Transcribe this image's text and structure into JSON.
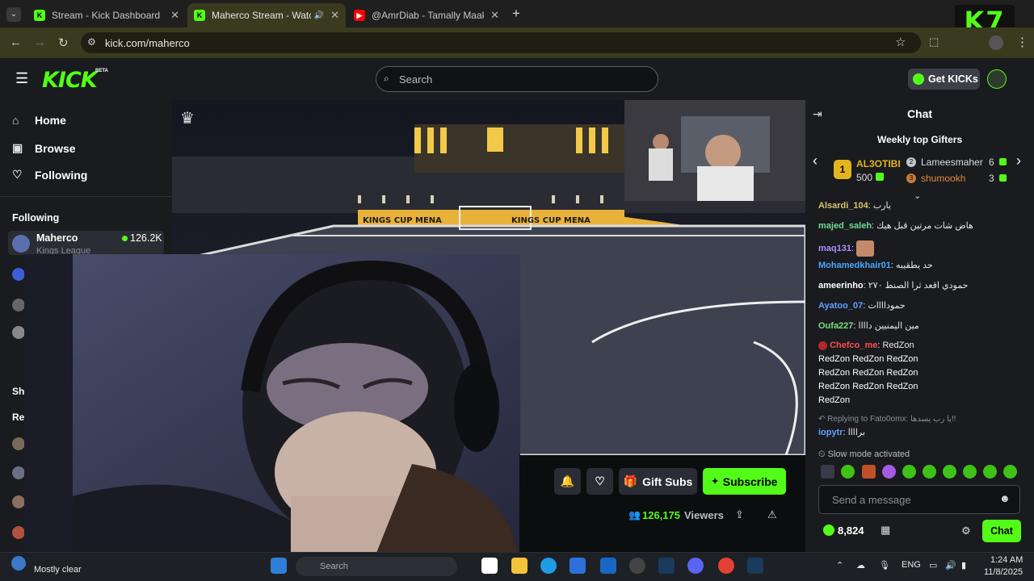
{
  "browser": {
    "tabs": [
      {
        "title": "Stream - Kick Dashboard",
        "favicon": "kick-icon"
      },
      {
        "title": "Maherco Stream - Watch Li",
        "favicon": "kick-icon"
      },
      {
        "title": "@AmrDiab - Tamally Maak | Off",
        "favicon": "youtube-icon"
      }
    ],
    "url": "kick.com/maherco",
    "overlay_badge": "K7"
  },
  "kick": {
    "logo": "KICK",
    "beta": "BETA",
    "search_placeholder": "Search",
    "get_kicks": "Get KICKs"
  },
  "sidebar": {
    "nav": [
      {
        "label": "Home",
        "icon": "home-icon"
      },
      {
        "label": "Browse",
        "icon": "browse-icon"
      },
      {
        "label": "Following",
        "icon": "heart-icon"
      }
    ],
    "following_heading": "Following",
    "channels": [
      {
        "name": "Maherco",
        "category": "Kings League",
        "viewers": "126.2K",
        "live": true
      }
    ],
    "partial_headings": [
      "She",
      "Re"
    ]
  },
  "stream": {
    "scoreboard_text": "KINGS CUP MENA",
    "actions": {
      "gift_subs": "Gift Subs",
      "subscribe": "Subscribe"
    },
    "viewers_count": "126,175",
    "viewers_label": "Viewers"
  },
  "chat": {
    "title": "Chat",
    "top_gifters_title": "Weekly top Gifters",
    "gifters": [
      {
        "rank": "1",
        "name": "AL3OTIBI",
        "count": "500"
      },
      {
        "rank": "2",
        "name": "Lameesmaher",
        "count": "6"
      },
      {
        "rank": "3",
        "name": "shumookh",
        "count": "3"
      }
    ],
    "messages": [
      {
        "user": "Alsardi_104",
        "text": "يارب",
        "color": "#d6c36a"
      },
      {
        "user": "majed_saleh",
        "text": "هاض شات مرتين قبل هيك",
        "color": "#6fdc91"
      },
      {
        "user": "maq131",
        "text": "",
        "color": "#b08cff"
      },
      {
        "user": "Mohamedkhair01",
        "text": "حد يطقيبه",
        "color": "#4aa8ff"
      },
      {
        "user": "ameerinho",
        "text": "حمودي اقعد ثرا الصنط ٢٧٠",
        "color": "#ffffff"
      },
      {
        "user": "Ayatoo_07",
        "text": "حموداااات",
        "color": "#62a3ff"
      },
      {
        "user": "Oufa227",
        "text": "مين اليمنيين داااا",
        "color": "#79e07b"
      },
      {
        "user": "Chefco_me",
        "text": "RedZon",
        "color": "#ff4f4f"
      }
    ],
    "redzon_lines": [
      "RedZon  RedZon  RedZon",
      "RedZon  RedZon  RedZon",
      "RedZon  RedZon  RedZon",
      "RedZon"
    ],
    "reply_line": "Replying to Fato0omx: يا رب يسدها!!",
    "reply_user": "iopytr",
    "reply_text": "براااا",
    "slow_mode": "Slow mode activated",
    "send_placeholder": "Send a message",
    "points": "8,824",
    "chat_button": "Chat"
  },
  "taskbar": {
    "weather": "Mostly clear",
    "search_placeholder": "Search",
    "lang": "ENG",
    "time": "1:24 AM",
    "date": "11/8/2025"
  },
  "colors": {
    "kick_green": "#53fc18",
    "panel_bg": "#191b1f",
    "chrome_tab": "#3a3a1f"
  }
}
